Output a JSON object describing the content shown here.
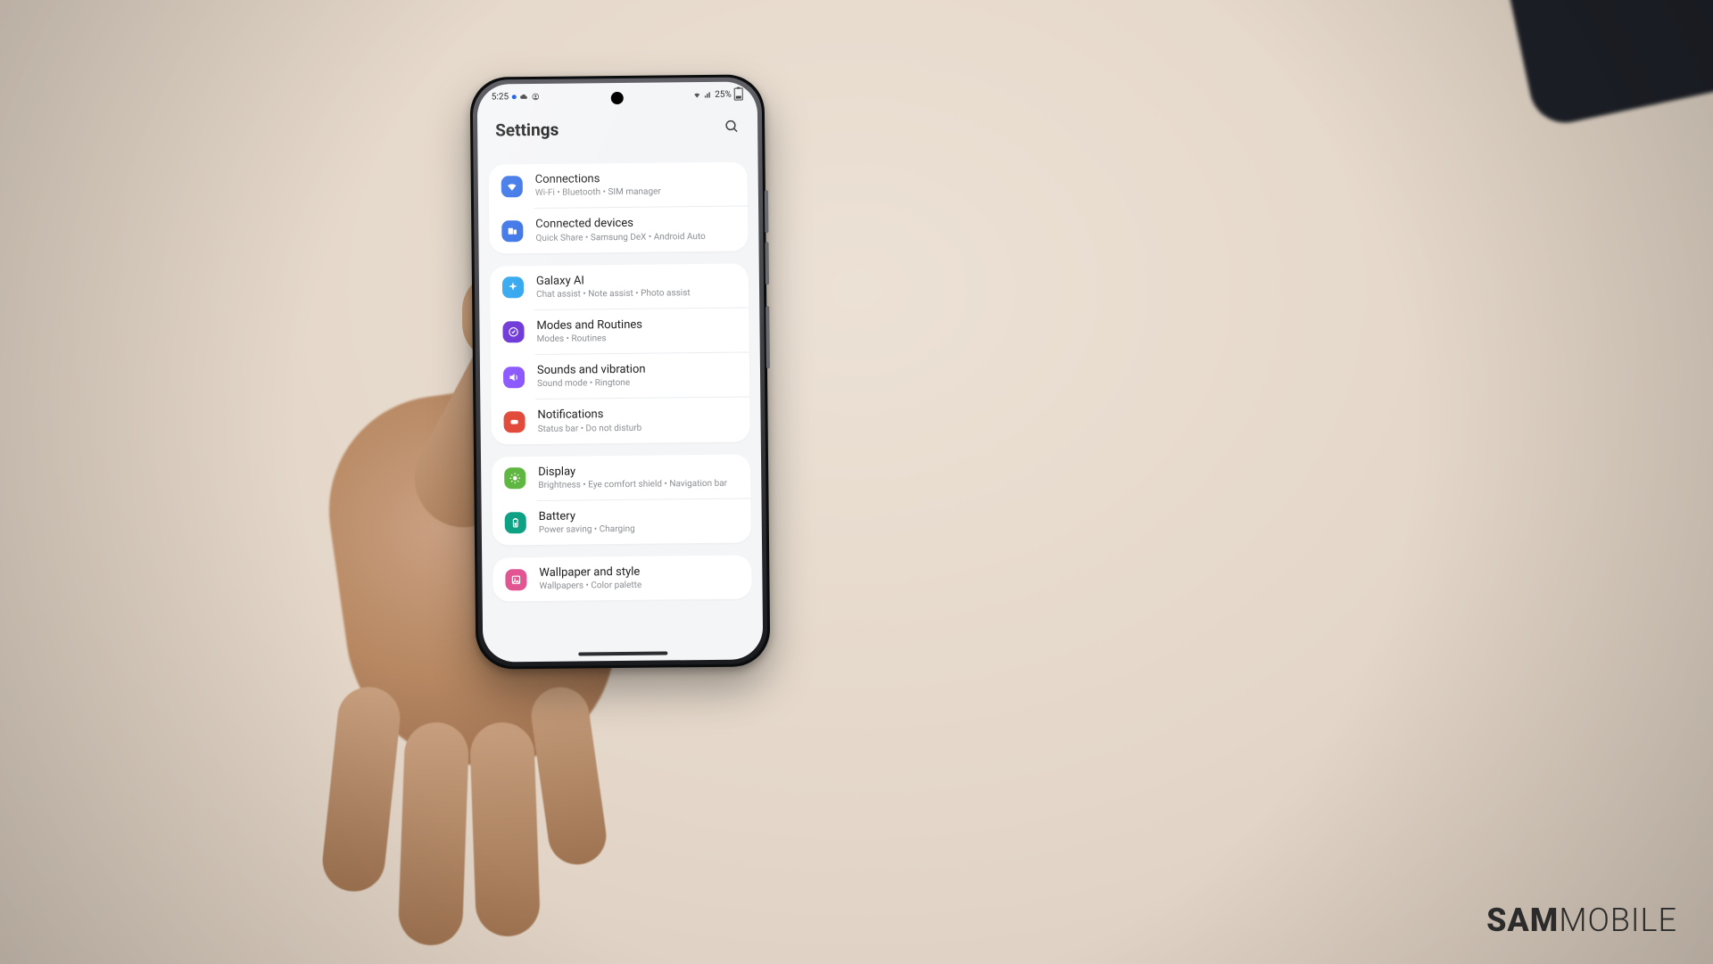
{
  "watermark": {
    "bold": "SAM",
    "light": "MOBILE"
  },
  "status": {
    "time": "5:25",
    "battery_pct": "25%"
  },
  "header": {
    "title": "Settings"
  },
  "groups": [
    {
      "items": [
        {
          "icon": "wifi-icon",
          "color": "#2e6be6",
          "title": "Connections",
          "sub": "Wi-Fi  •  Bluetooth  •  SIM manager"
        },
        {
          "icon": "devices-icon",
          "color": "#2e6be6",
          "title": "Connected devices",
          "sub": "Quick Share  •  Samsung DeX  •  Android Auto"
        }
      ]
    },
    {
      "items": [
        {
          "icon": "sparkle-icon",
          "color": "#2aa3ef",
          "title": "Galaxy AI",
          "sub": "Chat assist  •  Note assist  •  Photo assist"
        },
        {
          "icon": "routine-icon",
          "color": "#6a32d6",
          "title": "Modes and Routines",
          "sub": "Modes  •  Routines"
        },
        {
          "icon": "sound-icon",
          "color": "#8a56ff",
          "title": "Sounds and vibration",
          "sub": "Sound mode  •  Ringtone"
        },
        {
          "icon": "notif-icon",
          "color": "#e24b3b",
          "title": "Notifications",
          "sub": "Status bar  •  Do not disturb"
        }
      ]
    },
    {
      "items": [
        {
          "icon": "display-icon",
          "color": "#5fb641",
          "title": "Display",
          "sub": "Brightness  •  Eye comfort shield  •  Navigation bar"
        },
        {
          "icon": "battery-icon",
          "color": "#0fa184",
          "title": "Battery",
          "sub": "Power saving  •  Charging"
        }
      ]
    },
    {
      "items": [
        {
          "icon": "wallpaper-icon",
          "color": "#e25593",
          "title": "Wallpaper and style",
          "sub": "Wallpapers  •  Color palette"
        }
      ]
    }
  ]
}
